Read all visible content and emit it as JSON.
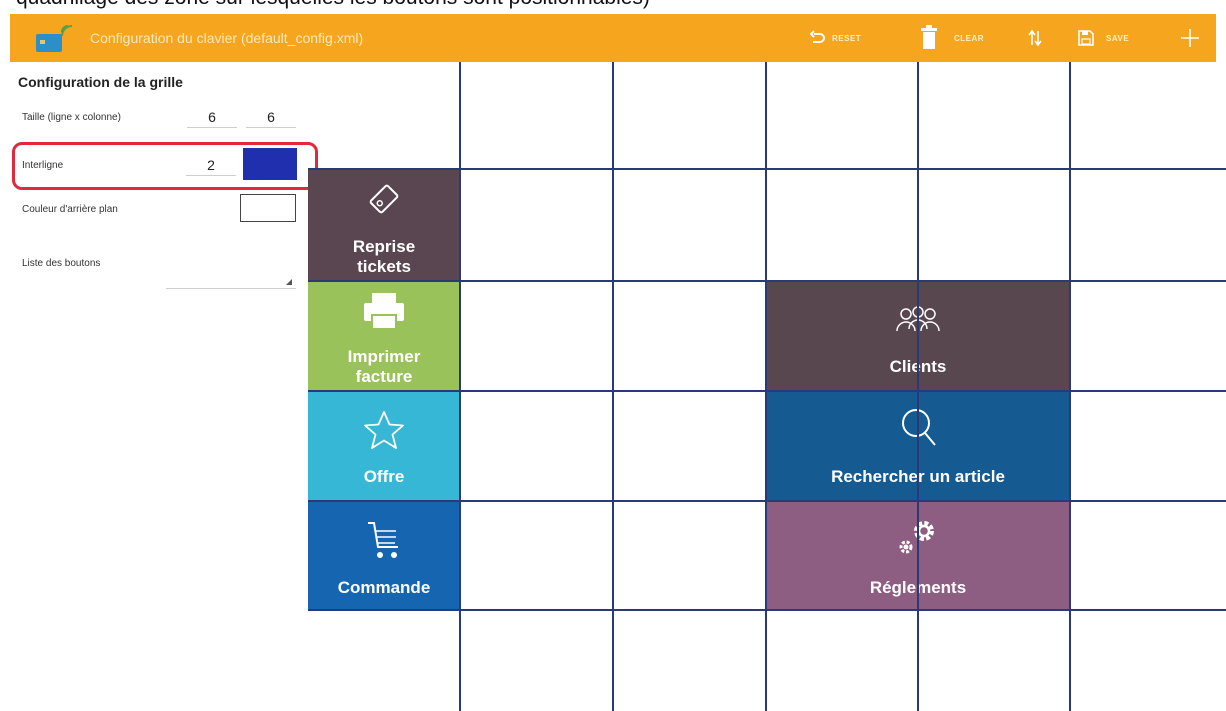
{
  "caption": "quadrillage des zone sur lesquelles les boutons sont positionnables)",
  "appbar": {
    "title": "Configuration du clavier (default_config.xml)",
    "actions": {
      "reset": "RESET",
      "clear": "CLEAR",
      "save": "SAVE"
    }
  },
  "panel": {
    "title": "Configuration de la grille",
    "size_label": "Taille (ligne x colonne)",
    "size_rows": "6",
    "size_cols": "6",
    "spacing_label": "Interligne",
    "spacing_value": "2",
    "spacing_color": "#1f2fae",
    "background_label": "Couleur d'arrière plan",
    "buttons_list_label": "Liste des boutons"
  },
  "tiles": {
    "reprise": {
      "label_line1": "Reprise",
      "label_line2": "tickets",
      "color": "#5a4650"
    },
    "imprimer": {
      "label_line1": "Imprimer",
      "label_line2": "facture",
      "color": "#9ac25a"
    },
    "offre": {
      "label": "Offre",
      "color": "#37b7d6"
    },
    "commande": {
      "label": "Commande",
      "color": "#1565b0"
    },
    "clients": {
      "label": "Clients",
      "color": "#594750"
    },
    "rechercher": {
      "label": "Rechercher un article",
      "color": "#155a90"
    },
    "reglements": {
      "label": "Réglements",
      "color": "#8d5e82"
    }
  },
  "colors": {
    "appbar": "#f6a51f",
    "grid_line": "#2a3a78",
    "highlight": "#e02a3a"
  }
}
